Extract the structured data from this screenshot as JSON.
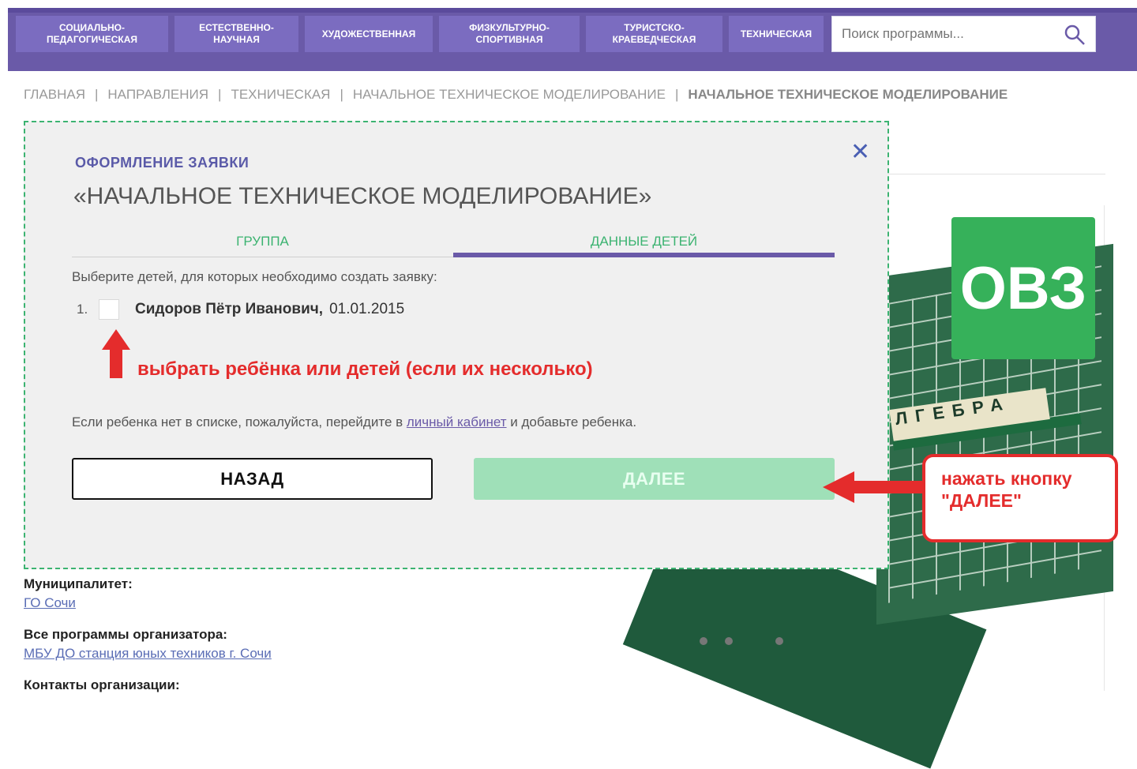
{
  "nav": {
    "items": [
      {
        "label": "СОЦИАЛЬНО-\nПЕДАГОГИЧЕСКАЯ"
      },
      {
        "label": "ЕСТЕСТВЕННО-\nНАУЧНАЯ"
      },
      {
        "label": "ХУДОЖЕСТВЕННАЯ"
      },
      {
        "label": "ФИЗКУЛЬТУРНО-\nСПОРТИВНАЯ"
      },
      {
        "label": "ТУРИСТСКО-\nКРАЕВЕДЧЕСКАЯ"
      },
      {
        "label": "ТЕХНИЧЕСКАЯ"
      }
    ],
    "search_placeholder": "Поиск программы..."
  },
  "breadcrumb": {
    "items": [
      "ГЛАВНАЯ",
      "НАПРАВЛЕНИЯ",
      "ТЕХНИЧЕСКАЯ",
      "НАЧАЛЬНОЕ ТЕХНИЧЕСКОЕ МОДЕЛИРОВАНИЕ"
    ],
    "current": "НАЧАЛЬНОЕ ТЕХНИЧЕСКОЕ МОДЕЛИРОВАНИЕ",
    "separator": "|"
  },
  "background": {
    "badge": "ОВЗ",
    "board_letters": "ЛГЕБРА",
    "municipality_label": "Муниципалитет:",
    "municipality_value": "ГО Сочи",
    "organizer_label": "Все программы организатора:",
    "organizer_value": "МБУ ДО станция юных техников г. Сочи",
    "contacts_label": "Контакты организации:"
  },
  "modal": {
    "close_icon": "close-icon",
    "subtitle": "ОФОРМЛЕНИЕ ЗАЯВКИ",
    "title": "«НАЧАЛЬНОЕ ТЕХНИЧЕСКОЕ МОДЕЛИРОВАНИЕ»",
    "tabs": [
      {
        "label": "ГРУППА"
      },
      {
        "label": "ДАННЫЕ ДЕТЕЙ"
      }
    ],
    "instruction": "Выберите детей, для которых необходимо создать заявку:",
    "children": [
      {
        "num": "1.",
        "name": "Сидоров Пётр Иванович,",
        "dob": "01.01.2015"
      }
    ],
    "note_before": "Если ребенка нет в списке, пожалуйста, перейдите в ",
    "note_link": "личный кабинет",
    "note_after": " и добавьте ребенка.",
    "back_label": "НАЗАД",
    "next_label": "ДАЛЕЕ"
  },
  "annotations": {
    "select_child": "выбрать ребёнка или детей (если их несколько)",
    "press_next": "нажать кнопку\n\"ДАЛЕЕ\"",
    "arrow_color": "#e42c2c"
  },
  "colors": {
    "header_bg": "#6a5aa8",
    "nav_item_bg": "#7b6cc0",
    "accent_green": "#3cb371",
    "accent_purple": "#6a5aa8",
    "annotation_red": "#e42c2c"
  }
}
